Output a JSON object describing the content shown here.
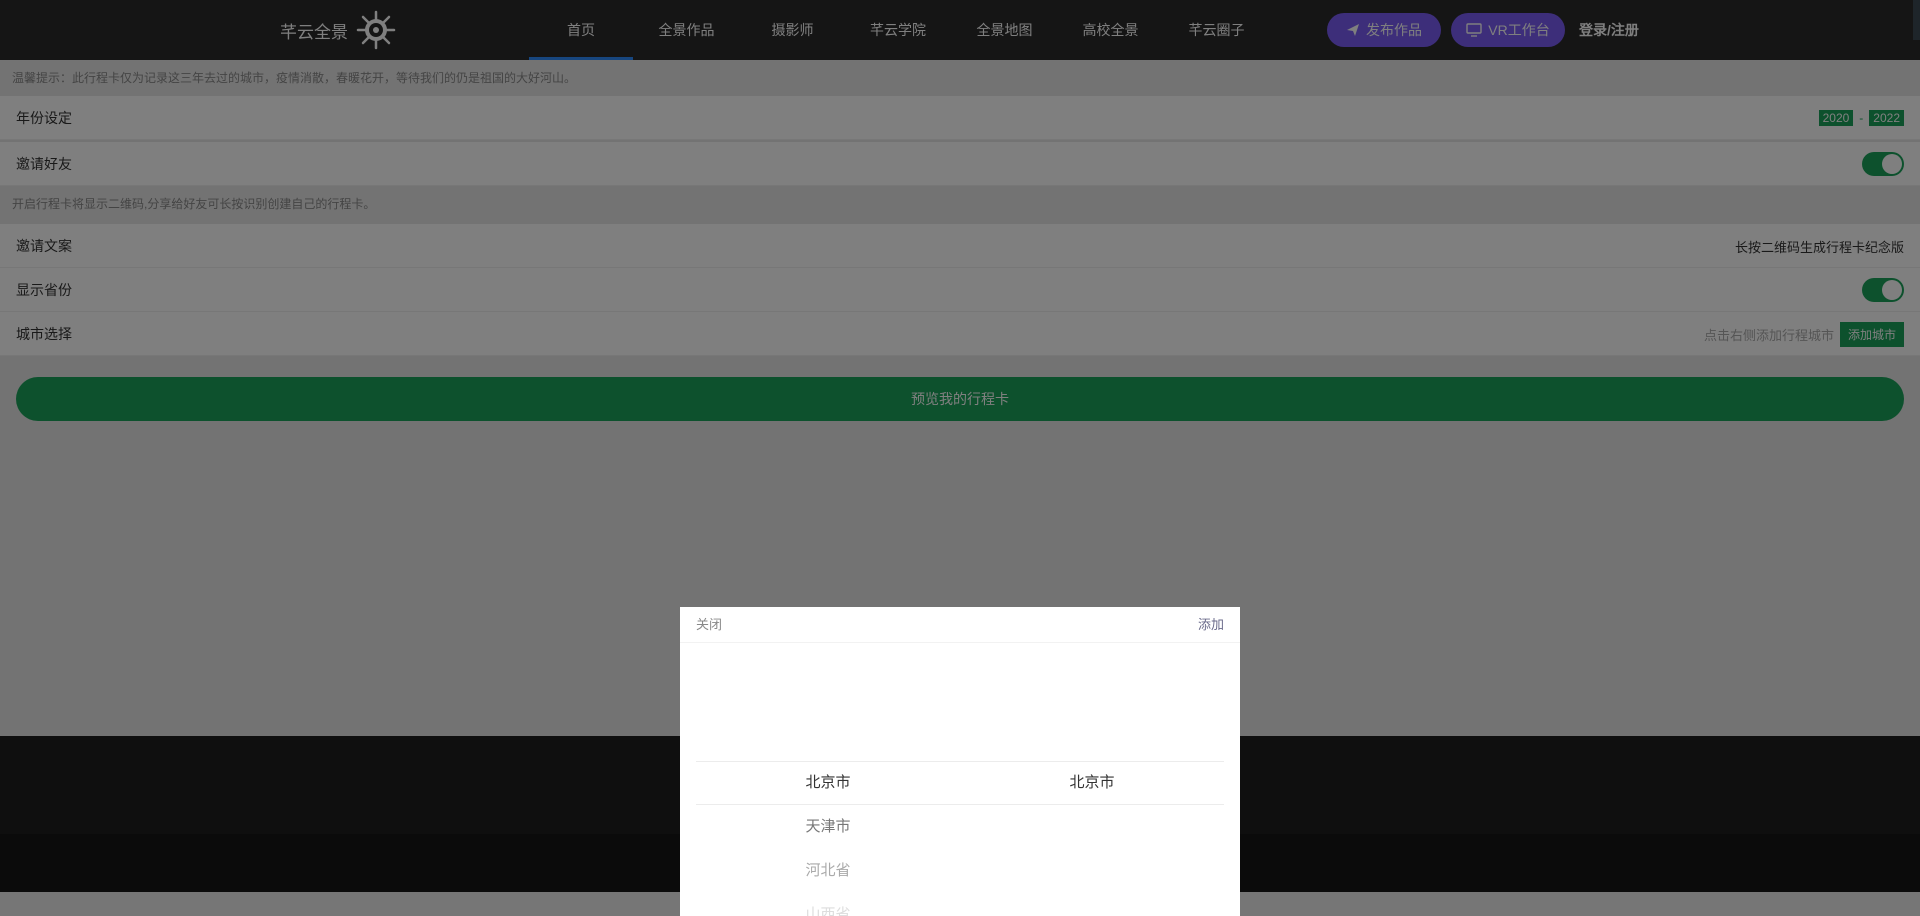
{
  "header": {
    "logo_text": "芊云全景",
    "logo_icon": "compass-emblem-icon",
    "nav": [
      {
        "label": "首页",
        "active": true
      },
      {
        "label": "全景作品",
        "active": false
      },
      {
        "label": "摄影师",
        "active": false
      },
      {
        "label": "芊云学院",
        "active": false
      },
      {
        "label": "全景地图",
        "active": false
      },
      {
        "label": "高校全景",
        "active": false
      },
      {
        "label": "芊云圈子",
        "active": false
      }
    ],
    "publish_label": "发布作品",
    "vr_label": "VR工作台",
    "login_label": "登录/注册",
    "accent_color": "#7b5cf5",
    "active_tab_color": "#2f8cff"
  },
  "page": {
    "tip": "温馨提示：此行程卡仅为记录这三年去过的城市，疫情消散，春暖花开，等待我们的仍是祖国的大好河山。",
    "year": {
      "label": "年份设定",
      "start": "2020",
      "sep": "-",
      "end": "2022"
    },
    "invite": {
      "label": "邀请好友",
      "on": true
    },
    "invite_tip": "开启行程卡将显示二维码,分享给好友可长按识别创建自己的行程卡。",
    "copy": {
      "label": "邀请文案",
      "value": "长按二维码生成行程卡纪念版"
    },
    "province": {
      "label": "显示省份",
      "on": true
    },
    "city": {
      "label": "城市选择",
      "hint": "点击右侧添加行程城市",
      "button": "添加城市"
    },
    "preview_button": "预览我的行程卡",
    "brand_green": "#1ba35a"
  },
  "picker": {
    "close_label": "关闭",
    "add_label": "添加",
    "provinces": [
      "北京市",
      "天津市",
      "河北省",
      "山西省"
    ],
    "cities": [
      "北京市"
    ]
  }
}
